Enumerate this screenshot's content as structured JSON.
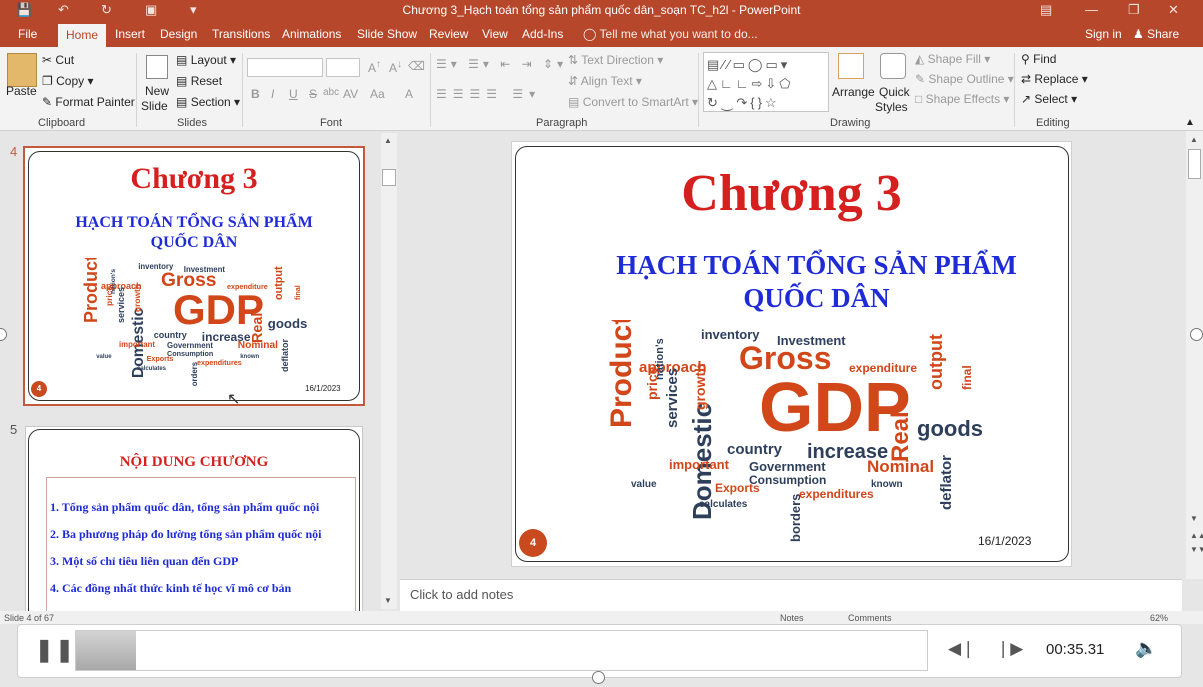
{
  "window": {
    "title": "Chương 3_Hạch toán tổng sản phẩm quốc dân_soạn TC_h2l - PowerPoint"
  },
  "tabs": [
    "File",
    "Home",
    "Insert",
    "Design",
    "Transitions",
    "Animations",
    "Slide Show",
    "Review",
    "View",
    "Add-Ins"
  ],
  "active_tab": "Home",
  "tell_me": "Tell me what you want to do...",
  "account": {
    "sign_in": "Sign in",
    "share": "Share"
  },
  "ribbon": {
    "clipboard": {
      "paste": "Paste",
      "cut": "Cut",
      "copy": "Copy",
      "format_painter": "Format Painter",
      "label": "Clipboard"
    },
    "slides": {
      "new_slide_1": "New",
      "new_slide_2": "Slide",
      "layout": "Layout",
      "reset": "Reset",
      "section": "Section",
      "label": "Slides"
    },
    "font": {
      "bold": "B",
      "italic": "I",
      "underline": "U",
      "strike": "S",
      "shadow": "abc",
      "spacing": "AV",
      "case": "Aa",
      "color": "A",
      "label": "Font"
    },
    "paragraph": {
      "text_direction": "Text Direction",
      "align_text": "Align Text",
      "convert_smartart": "Convert to SmartArt",
      "label": "Paragraph"
    },
    "drawing": {
      "arrange": "Arrange",
      "quick_styles_1": "Quick",
      "quick_styles_2": "Styles",
      "shape_fill": "Shape Fill",
      "shape_outline": "Shape Outline",
      "shape_effects": "Shape Effects",
      "label": "Drawing"
    },
    "editing": {
      "find": "Find",
      "replace": "Replace",
      "select": "Select",
      "label": "Editing"
    }
  },
  "thumbnails": [
    {
      "number": "4",
      "title": "Chương 3",
      "sub1": "HẠCH TOÁN TỔNG SẢN PHẨM",
      "sub2": "QUỐC DÂN",
      "badge": "4",
      "date": "16/1/2023"
    },
    {
      "number": "5",
      "heading": "NỘI DUNG CHƯƠNG",
      "items": [
        "1. Tổng sản phẩm quốc dân, tổng sản phẩm quốc nội",
        "2. Ba phương pháp đo lường tổng sản phẩm quốc nội",
        "3. Một số chỉ tiêu liên quan đến GDP",
        "4. Các đồng nhất thức kinh tế học vĩ mô cơ bản"
      ]
    }
  ],
  "slide": {
    "title": "Chương 3",
    "sub1": "HẠCH TOÁN TỔNG SẢN PHẨM",
    "sub2": "QUỐC DÂN",
    "badge": "4",
    "date": "16/1/2023"
  },
  "wordcloud": {
    "gdp": "GDP",
    "gross": "Gross",
    "product": "Product",
    "domestic": "Domestic",
    "goods": "goods",
    "country": "country",
    "increase": "increase",
    "real": "Real",
    "nominal": "Nominal",
    "inventory": "inventory",
    "investment": "Investment",
    "approach": "approach",
    "expenditure": "expenditure",
    "output": "output",
    "services": "services",
    "growth": "growth",
    "price": "price",
    "government": "Government",
    "consumption": "Consumption",
    "exports": "Exports",
    "expenditures": "expenditures",
    "important": "important",
    "deflator": "deflator",
    "value": "value",
    "calculates": "calculates",
    "borders": "borders",
    "known": "known",
    "final": "final",
    "nations": "nation's"
  },
  "notes_placeholder": "Click to add notes",
  "status": {
    "slide_of": "Slide 4 of 67",
    "notes": "Notes",
    "comments": "Comments",
    "zoom": "62%"
  },
  "player": {
    "time": "00:35.31",
    "progress": 0.07
  },
  "colors": {
    "accent": "#b7472a",
    "title_red": "#d61f1f",
    "subtitle_blue": "#1f2bd6",
    "badge": "#c94a1f",
    "cloud_orange": "#d1471a",
    "cloud_navy": "#2e3f5c"
  }
}
